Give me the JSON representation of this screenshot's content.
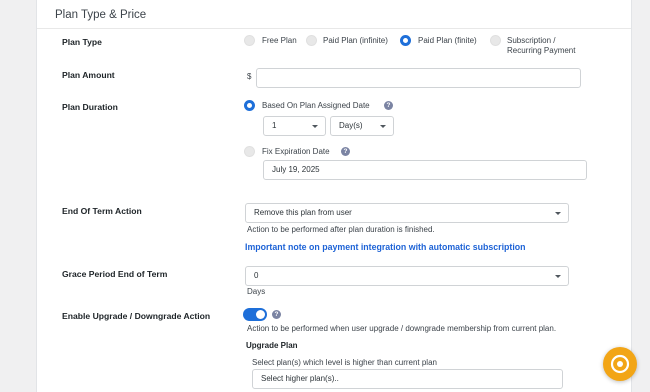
{
  "section": {
    "title": "Plan Type & Price"
  },
  "plan_type": {
    "label": "Plan Type",
    "options": [
      {
        "label": "Free Plan",
        "selected": false
      },
      {
        "label": "Paid Plan (infinite)",
        "selected": false
      },
      {
        "label": "Paid Plan (finite)",
        "selected": true
      },
      {
        "label": "Subscription / Recurring Payment",
        "selected": false
      }
    ]
  },
  "plan_amount": {
    "label": "Plan Amount",
    "currency": "$",
    "value": ""
  },
  "plan_duration": {
    "label": "Plan Duration",
    "option_assigned": "Based On Plan Assigned Date",
    "count_value": "1",
    "unit_value": "Day(s)",
    "option_fixed": "Fix Expiration Date",
    "expiration_date": "July 19, 2025"
  },
  "end_of_term": {
    "label": "End Of Term Action",
    "value": "Remove this plan from user",
    "help": "Action to be performed after plan duration is finished.",
    "note_link": "Important note on payment integration with automatic subscription"
  },
  "grace_period": {
    "label": "Grace Period End of Term",
    "value": "0",
    "unit": "Days"
  },
  "upgrade": {
    "label": "Enable Upgrade / Downgrade Action",
    "enabled": true,
    "help": "Action to be performed when user upgrade / downgrade membership from current plan.",
    "sub_label": "Upgrade Plan",
    "sub_help": "Select plan(s) which level is higher than current plan",
    "placeholder": "Select higher plan(s).."
  },
  "colors": {
    "accent": "#1e6fd9",
    "link": "#1e63d6",
    "fab": "#f2a516"
  },
  "icons": {
    "help": "question-circle-icon",
    "dropdown": "chevron-down-icon",
    "fab": "support-icon"
  }
}
